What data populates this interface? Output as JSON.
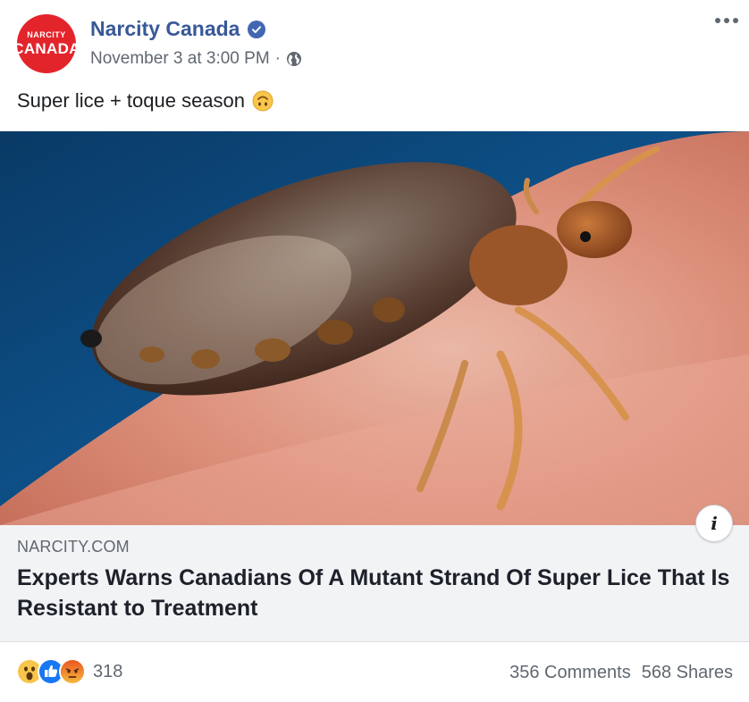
{
  "post": {
    "avatar": {
      "line1": "NARCITY",
      "line2": "CANADA",
      "color": "#e3242b"
    },
    "page_name": "Narcity Canada",
    "verified_icon": "verified-badge-icon",
    "timestamp": "November 3 at 3:00 PM",
    "separator": "·",
    "privacy_icon": "globe-icon",
    "more_icon": "more-options-icon",
    "text": "Super lice + toque season",
    "text_emoji": "upside-down-face-icon"
  },
  "photo": {
    "subject_icon": "head-louse-photo"
  },
  "link_preview": {
    "domain": "NARCITY.COM",
    "title": "Experts Warns Canadians Of A Mutant Strand Of Super Lice That Is Resistant to Treatment",
    "info_label": "i"
  },
  "footer": {
    "reactions": [
      "wow-reaction-icon",
      "like-reaction-icon",
      "angry-reaction-icon"
    ],
    "reaction_count": "318",
    "comments": "356 Comments",
    "shares": "568 Shares"
  },
  "colors": {
    "link_blue": "#385898",
    "meta_gray": "#606770",
    "preview_bg": "#f2f3f5",
    "like_blue": "#1877f2"
  }
}
